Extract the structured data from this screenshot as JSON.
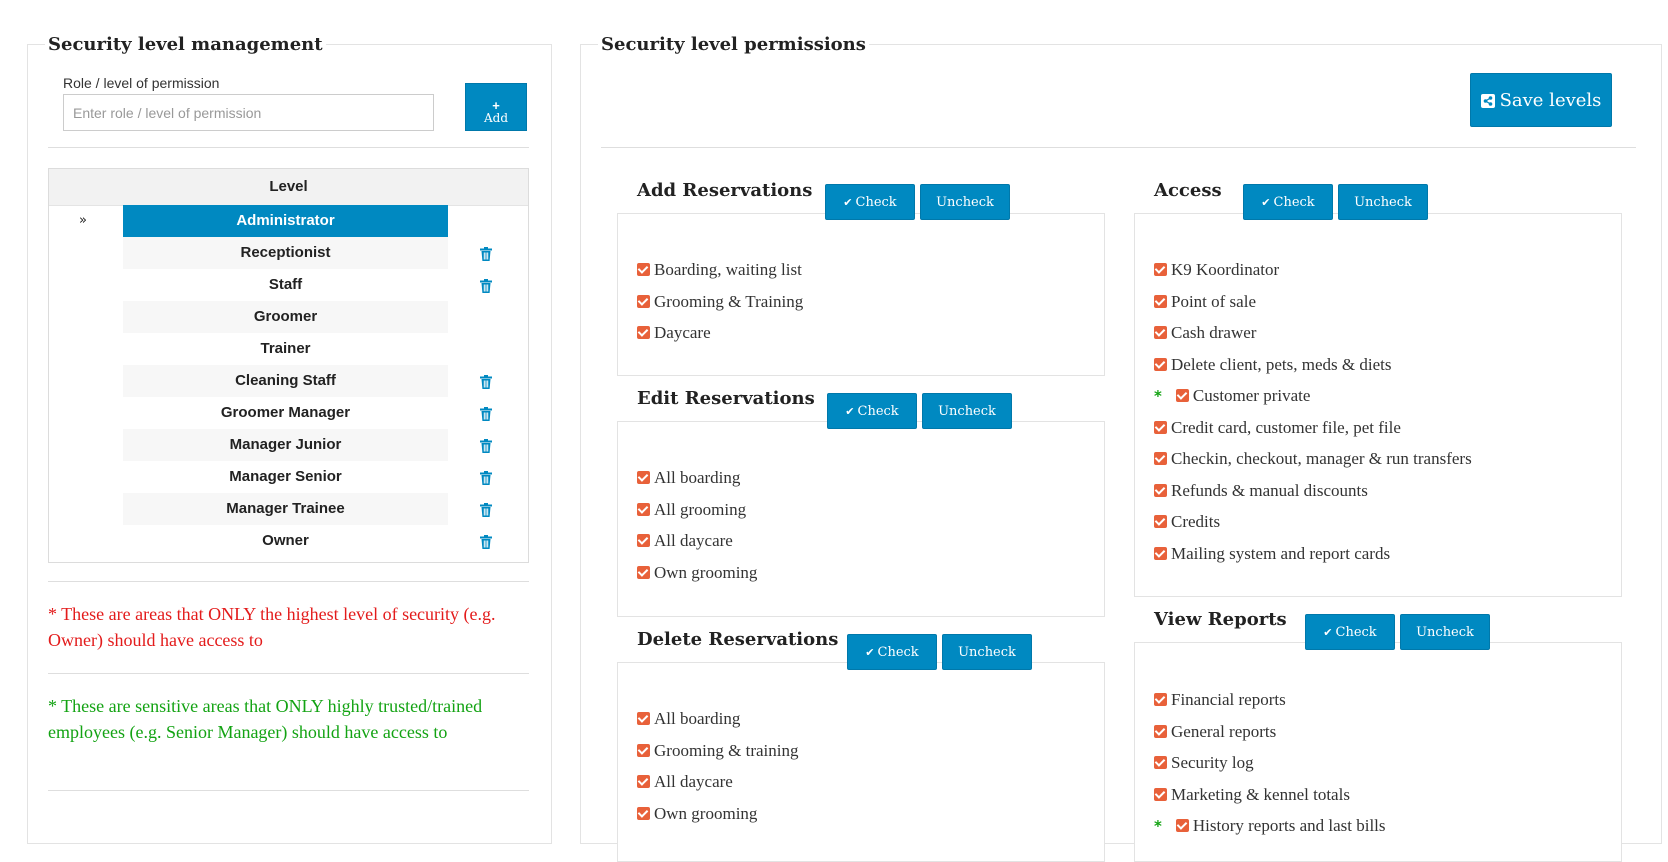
{
  "left_panel": {
    "title": "Security level management",
    "role_label": "Role / level of permission",
    "role_input": {
      "value": "",
      "placeholder": "Enter role / level of permission"
    },
    "add_button": {
      "icon": "plus-icon",
      "label": "Add"
    },
    "table_header": "Level",
    "active_marker": "»",
    "levels": [
      {
        "name": "Administrator",
        "active": true,
        "deletable": false
      },
      {
        "name": "Receptionist",
        "deletable": true
      },
      {
        "name": "Staff",
        "deletable": true
      },
      {
        "name": "Groomer",
        "deletable": false
      },
      {
        "name": "Trainer",
        "deletable": false
      },
      {
        "name": "Cleaning Staff",
        "deletable": true
      },
      {
        "name": "Groomer Manager",
        "deletable": true
      },
      {
        "name": "Manager Junior",
        "deletable": true
      },
      {
        "name": "Manager Senior",
        "deletable": true
      },
      {
        "name": "Manager Trainee",
        "deletable": true
      },
      {
        "name": "Owner",
        "deletable": true
      }
    ],
    "note_red": "* These are areas that ONLY the highest level of security (e.g. Owner) should have access to",
    "note_green": "* These are sensitive areas that ONLY highly trusted/trained employees (e.g. Senior Manager) should have access to"
  },
  "right_panel": {
    "title": "Security level permissions",
    "save_button": {
      "icon": "share-icon",
      "label": "Save levels"
    },
    "check_label": "Check",
    "uncheck_label": "Uncheck",
    "groups": [
      {
        "id": "add-reservations",
        "title": "Add Reservations",
        "items": [
          {
            "label": "Boarding, waiting list",
            "checked": true
          },
          {
            "label": "Grooming & Training",
            "checked": true
          },
          {
            "label": "Daycare",
            "checked": true
          }
        ]
      },
      {
        "id": "edit-reservations",
        "title": "Edit Reservations",
        "items": [
          {
            "label": "All boarding",
            "checked": true
          },
          {
            "label": "All grooming",
            "checked": true
          },
          {
            "label": "All daycare",
            "checked": true
          },
          {
            "label": "Own grooming",
            "checked": true
          }
        ]
      },
      {
        "id": "delete-reservations",
        "title": "Delete Reservations",
        "items": [
          {
            "label": "All boarding",
            "checked": true
          },
          {
            "label": "Grooming & training",
            "checked": true
          },
          {
            "label": "All daycare",
            "checked": true
          },
          {
            "label": "Own grooming",
            "checked": true
          }
        ]
      },
      {
        "id": "access",
        "title": "Access",
        "items": [
          {
            "label": "K9 Koordinator",
            "checked": true
          },
          {
            "label": "Point of sale",
            "checked": true
          },
          {
            "label": "Cash drawer",
            "checked": true
          },
          {
            "label": "Delete client, pets, meds & diets",
            "checked": true
          },
          {
            "label": "Customer private",
            "checked": true,
            "marker": "*",
            "marker_color": "#13a313"
          },
          {
            "label": "Credit card, customer file, pet file",
            "checked": true
          },
          {
            "label": "Checkin, checkout, manager & run transfers",
            "checked": true
          },
          {
            "label": "Refunds & manual discounts",
            "checked": true
          },
          {
            "label": "Credits",
            "checked": true
          },
          {
            "label": "Mailing system and report cards",
            "checked": true
          }
        ]
      },
      {
        "id": "view-reports",
        "title": "View Reports",
        "items": [
          {
            "label": "Financial reports",
            "checked": true
          },
          {
            "label": "General reports",
            "checked": true
          },
          {
            "label": "Security log",
            "checked": true
          },
          {
            "label": "Marketing & kennel totals",
            "checked": true
          },
          {
            "label": "History reports and last bills",
            "checked": true,
            "marker": "*",
            "marker_color": "#13a313"
          }
        ]
      }
    ]
  },
  "colors": {
    "accent": "#0089c1",
    "checkbox": "#e8613a",
    "red_note": "#e31b1b",
    "green_note": "#13a313"
  }
}
